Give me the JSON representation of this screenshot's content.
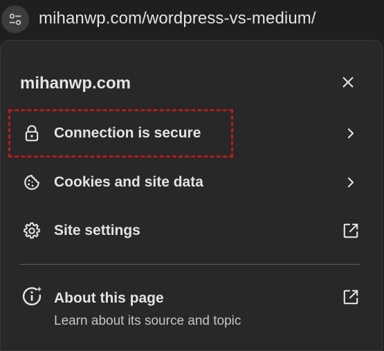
{
  "omnibox": {
    "url": "mihanwp.com/wordpress-vs-medium/"
  },
  "popup": {
    "title": "mihanwp.com",
    "items": [
      {
        "label": "Connection is secure"
      },
      {
        "label": "Cookies and site data"
      },
      {
        "label": "Site settings"
      }
    ],
    "about": {
      "label": "About this page",
      "subtitle": "Learn about its source and topic"
    }
  },
  "icons": {
    "omnibox": "tune-icon",
    "close": "close-icon",
    "connection": "lock-icon",
    "cookies": "cookie-icon",
    "settings": "gear-icon",
    "about": "info-sparkle-icon",
    "chevron": "chevron-right-icon",
    "external": "open-in-new-icon"
  },
  "colors": {
    "background": "#202124",
    "popup": "#282828",
    "text": "#e3e3e3",
    "highlight": "#b71c1c"
  }
}
